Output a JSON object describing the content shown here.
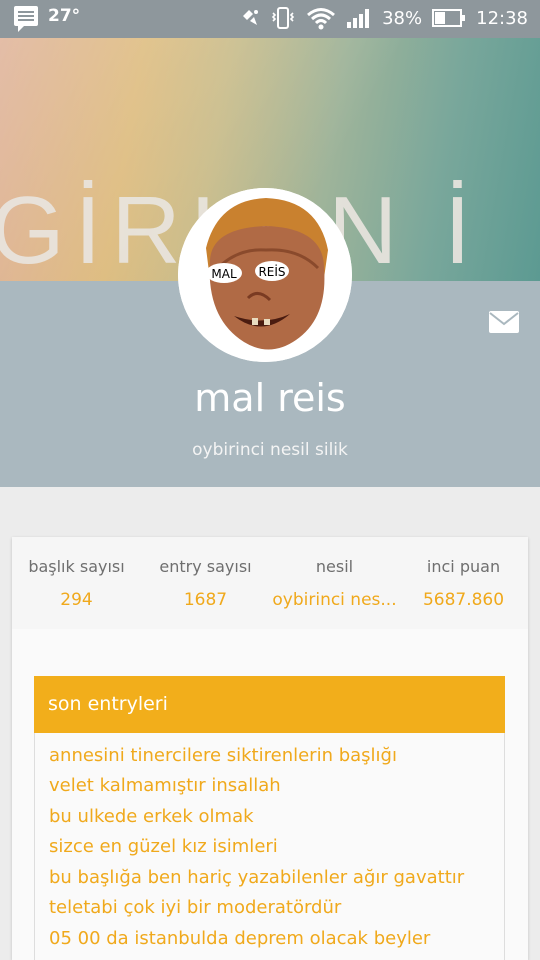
{
  "status_bar": {
    "temperature": "27°",
    "battery": "38%",
    "time": "12:38"
  },
  "cover": {
    "text": "GİRLAN İ"
  },
  "profile": {
    "name": "mal reis",
    "subtitle": "oybirinci nesil silik",
    "avatar_labels": [
      "MAL",
      "REİS"
    ]
  },
  "stats": [
    {
      "label": "başlık sayısı",
      "value": "294"
    },
    {
      "label": "entry sayısı",
      "value": "1687"
    },
    {
      "label": "nesil",
      "value": "oybirinci nes..."
    },
    {
      "label": "inci puan",
      "value": "5687.860"
    }
  ],
  "entries_section": {
    "title": "son entryleri",
    "items": [
      "annesini tinercilere siktirenlerin başlığı",
      "velet kalmamıştır insallah",
      "bu ulkede erkek olmak",
      "sizce en güzel kız isimleri",
      "bu başlığa ben hariç yazabilenler ağır gavattır",
      "teletabi çok iyi bir moderatördür",
      "05 00 da istanbulda deprem olacak beyler"
    ]
  },
  "colors": {
    "accent": "#f2ae1b",
    "band": "#aab8bf",
    "status_bar": "#8e979c"
  }
}
